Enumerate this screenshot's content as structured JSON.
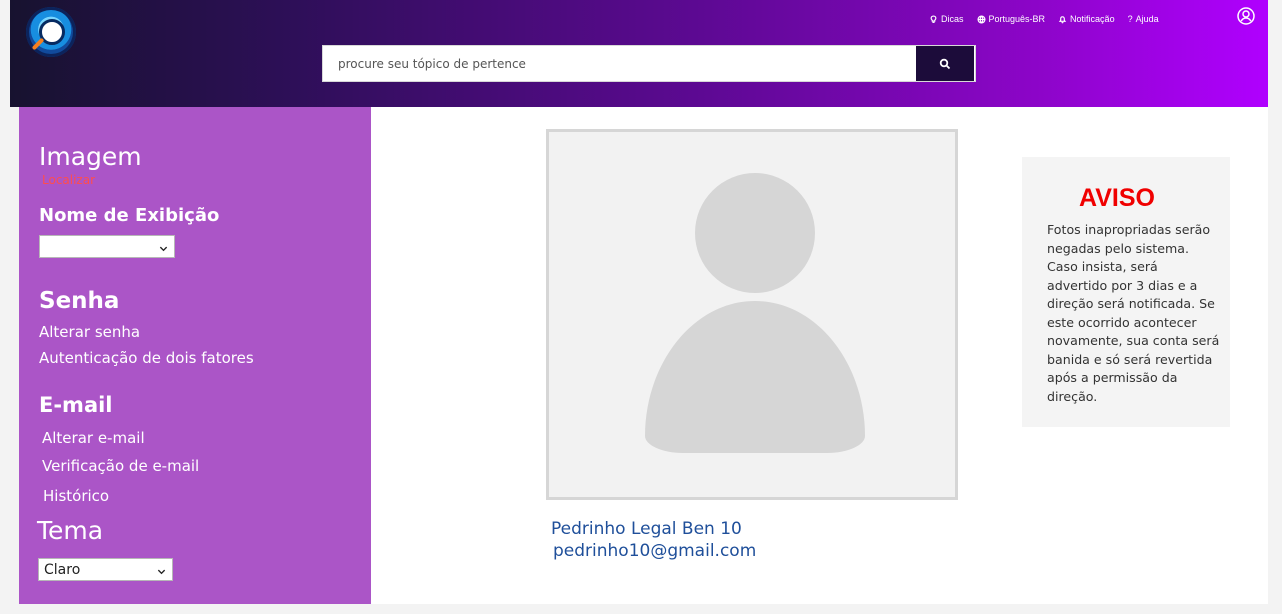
{
  "header": {
    "logo_name": "magnifier-logo",
    "top_links": [
      {
        "label": "Dicas",
        "icon": "lightbulb-icon"
      },
      {
        "label": "Português-BR",
        "icon": "globe-icon"
      },
      {
        "label": "Notificação",
        "icon": "bell-icon"
      },
      {
        "label": "Ajuda",
        "icon": "question-icon"
      }
    ],
    "profile_icon": "user-circle-icon"
  },
  "search": {
    "placeholder": "procure seu tópico de pertence",
    "button_icon": "search-icon"
  },
  "sidebar": {
    "image_title": "Imagem",
    "image_link": "Localizar",
    "display_name_title": "Nome de Exibição",
    "display_name_value": "",
    "password_title": "Senha",
    "password_links": [
      "Alterar senha",
      "Autenticação de dois fatores"
    ],
    "email_title": "E-mail",
    "email_links": [
      "Alterar e-mail",
      "Verificação de e-mail",
      "Histórico"
    ],
    "theme_title": "Tema",
    "theme_value": "Claro"
  },
  "profile": {
    "name": "Pedrinho Legal Ben 10",
    "email": "pedrinho10@gmail.com"
  },
  "notice": {
    "title": "AVISO",
    "text": "Fotos inapropriadas serão negadas pelo sistema. Caso insista, será advertido por 3 dias e a direção será notificada. Se este ocorrido acontecer novamente, sua conta será banida e só será revertida após a permissão da direção."
  },
  "colors": {
    "header_gradient_start": "#17122f",
    "header_gradient_end": "#b000ff",
    "sidebar": "#ab55c7",
    "warning_red": "#f00000",
    "link_red": "#ff4d4d",
    "profile_text": "#1f4f9a"
  }
}
